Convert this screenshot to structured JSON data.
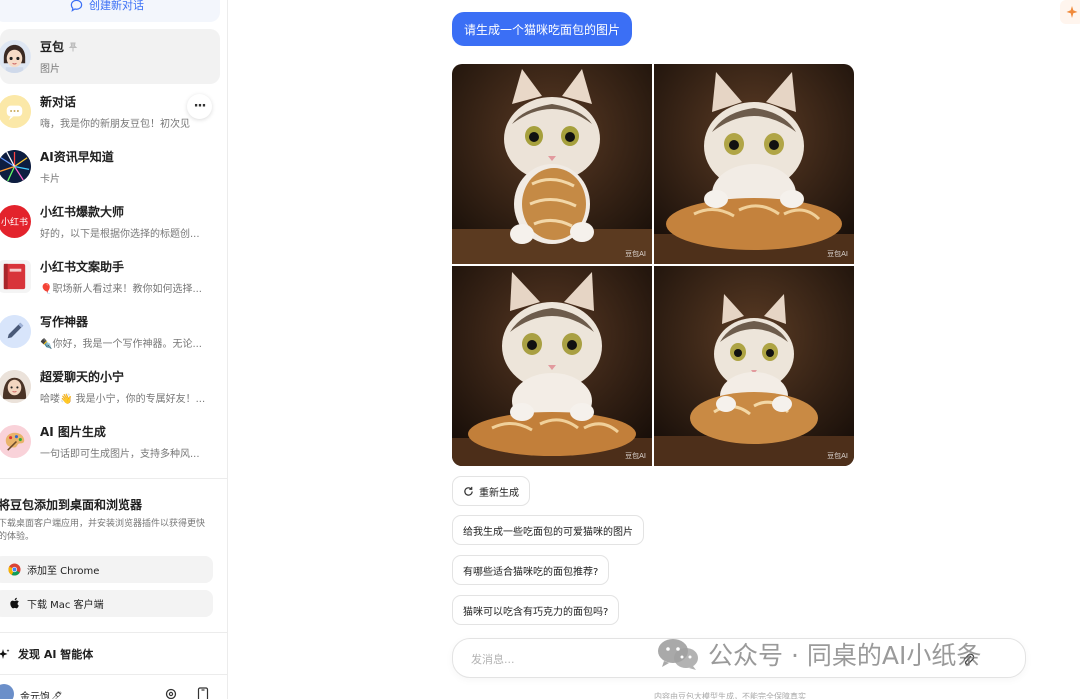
{
  "sidebar": {
    "new_chat_label": "创建新对话",
    "conversations": [
      {
        "title": "豆包",
        "subtitle": "图片",
        "avatar": "doubao-girl-avatar",
        "pinned": true,
        "active": true
      },
      {
        "title": "新对话",
        "subtitle": "嗨，我是你的新朋友豆包！初次见",
        "avatar": "chat-bubble-avatar"
      },
      {
        "title": "AI资讯早知道",
        "subtitle": "卡片",
        "avatar": "firework-avatar"
      },
      {
        "title": "小红书爆款大师",
        "subtitle": "好的，以下是根据你选择的标题创...",
        "avatar": "xiaohongshu-avatar",
        "avatar_text": "小红书"
      },
      {
        "title": "小红书文案助手",
        "subtitle": "🎈职场新人看过来！教你如何选择...",
        "avatar": "red-book-avatar"
      },
      {
        "title": "写作神器",
        "subtitle": "✒️你好，我是一个写作神器。无论...",
        "avatar": "pen-avatar"
      },
      {
        "title": "超爱聊天的小宁",
        "subtitle": "哈喽👋 我是小宁，你的专属好友！...",
        "avatar": "girl-avatar"
      },
      {
        "title": "AI 图片生成",
        "subtitle": "一句话即可生成图片，支持多种风...",
        "avatar": "palette-avatar"
      }
    ],
    "more_label": "···",
    "promo": {
      "title": "将豆包添加到桌面和浏览器",
      "description": "下载桌面客户端应用，并安装浏览器插件以获得更快的体验。",
      "chrome_button": "添加至 Chrome",
      "mac_button": "下载 Mac 客户端"
    },
    "discover_label": "发现 AI 智能体",
    "user_name": "金元饱🖊"
  },
  "main": {
    "user_message": "请生成一个猫咪吃面包的图片",
    "images": [
      {
        "watermark": "豆包AI"
      },
      {
        "watermark": "豆包AI"
      },
      {
        "watermark": "豆包AI"
      },
      {
        "watermark": "豆包AI"
      }
    ],
    "regenerate_label": "重新生成",
    "suggestions": [
      "给我生成一些吃面包的可爱猫咪的图片",
      "有哪些适合猫咪吃的面包推荐?",
      "猫咪可以吃含有巧克力的面包吗?"
    ],
    "input_placeholder": "发消息...",
    "footer_note": "内容由豆包大模型生成，不能完全保障真实"
  },
  "overlay_watermark": {
    "text": "公众号 · 同桌的AI小纸条"
  },
  "colors": {
    "accent": "#3b6ff5",
    "sidebar_active": "#f2f2f2",
    "chip_border": "#e3e3e3"
  }
}
